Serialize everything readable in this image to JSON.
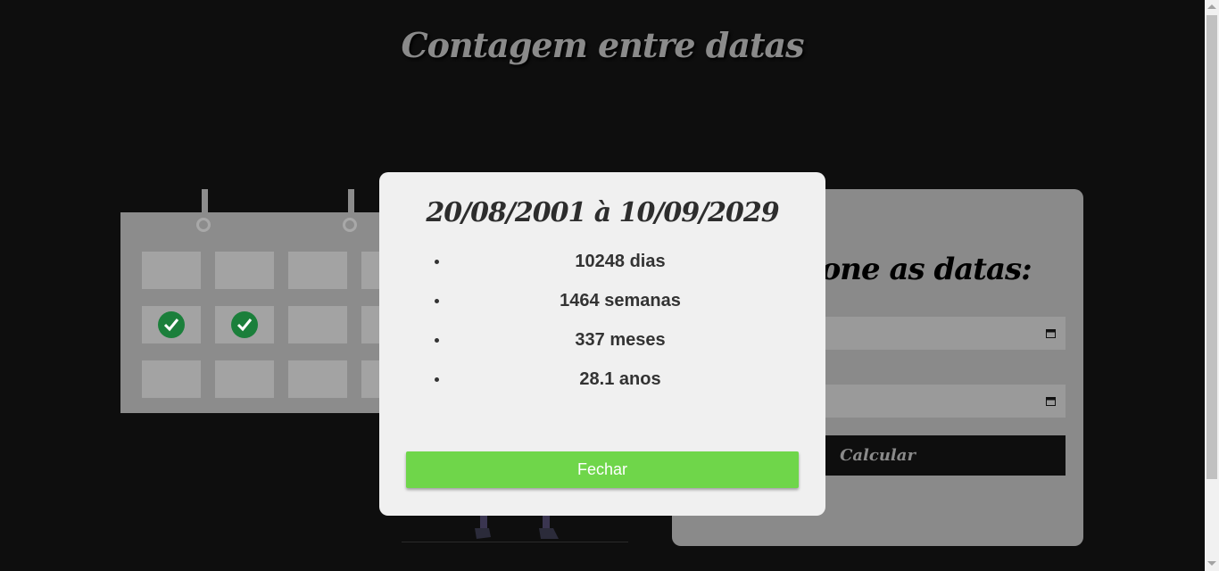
{
  "header": {
    "title": "Contagem entre datas"
  },
  "form": {
    "heading": "Selecione as datas:",
    "calculate_label": "Calcular"
  },
  "modal": {
    "title": "20/08/2001 à 10/09/2029",
    "results": [
      "10248 dias",
      "1464 semanas",
      "337 meses",
      "28.1 anos"
    ],
    "close_label": "Fechar"
  },
  "colors": {
    "background": "#0e0e0e",
    "modal_bg": "#f0f0f0",
    "close_button": "#6fd64a",
    "check_green": "#1b7f3b"
  },
  "icons": [
    "check-icon",
    "calendar-picker-icon"
  ]
}
